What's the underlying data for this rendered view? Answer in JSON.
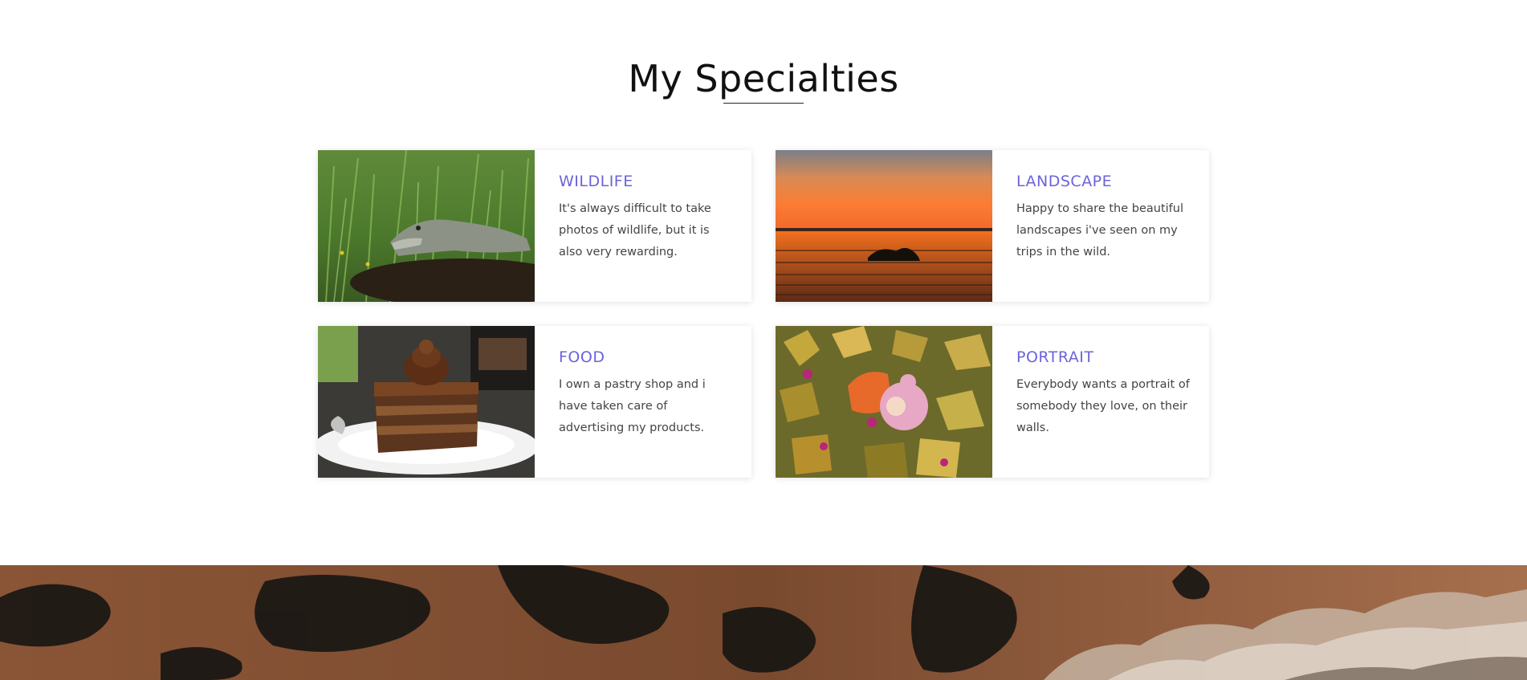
{
  "section": {
    "title": "My Specialties"
  },
  "cards": [
    {
      "heading": "WILDLIFE",
      "text": "It's always difficult to take photos of wildlife, but it is also very rewarding.",
      "image": "alligator-photo"
    },
    {
      "heading": "LANDSCAPE",
      "text": "Happy to share the beautiful landscapes i've seen on my trips in the wild.",
      "image": "sunset-lake-photo"
    },
    {
      "heading": "FOOD",
      "text": "I own a pastry shop and i have taken care of advertising my products.",
      "image": "chocolate-cake-photo"
    },
    {
      "heading": "PORTRAIT",
      "text": "Everybody wants a portrait of somebody they love, on their walls.",
      "image": "child-in-leaves-photo"
    }
  ],
  "colors": {
    "accent": "#6c63d9",
    "title": "#111111",
    "body_text": "#444444",
    "background": "#ffffff"
  },
  "footer": {
    "image": "aerial-coastline-photo"
  }
}
